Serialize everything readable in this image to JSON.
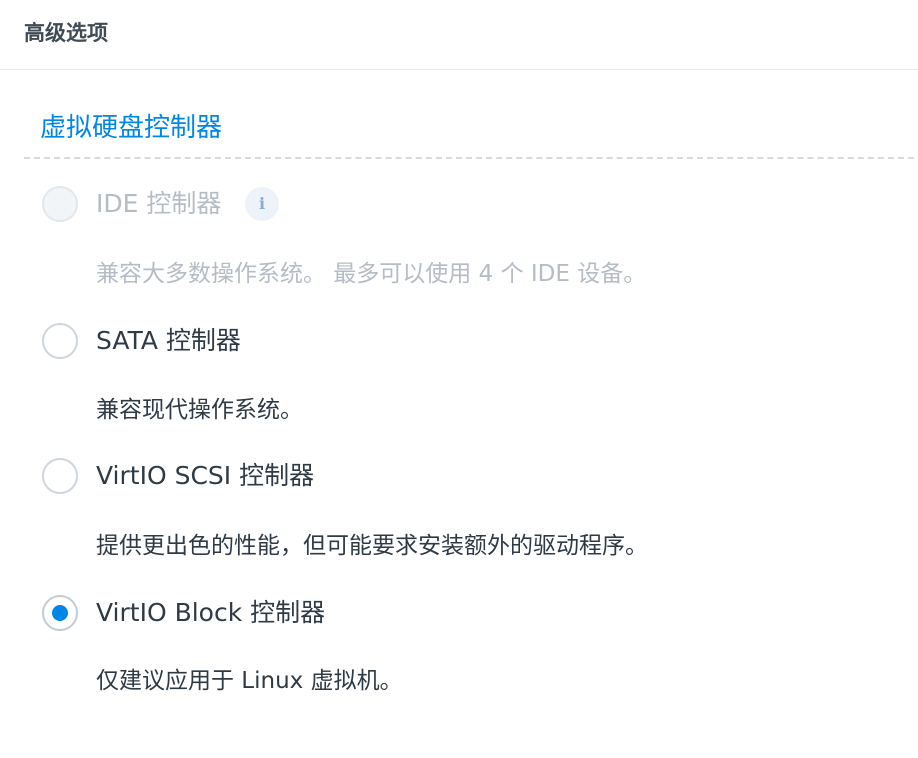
{
  "header": {
    "title": "高级选项"
  },
  "section": {
    "title": "虚拟硬盘控制器"
  },
  "options": [
    {
      "label": "IDE 控制器",
      "description": "兼容大多数操作系统。 最多可以使用 4 个 IDE 设备。",
      "disabled": true,
      "checked": false,
      "info_icon": "i"
    },
    {
      "label": "SATA 控制器",
      "description": "兼容现代操作系统。",
      "disabled": false,
      "checked": false
    },
    {
      "label": "VirtIO SCSI 控制器",
      "description": "提供更出色的性能，但可能要求安装额外的驱动程序。",
      "disabled": false,
      "checked": false
    },
    {
      "label": "VirtIO Block 控制器",
      "description": "仅建议应用于 Linux 虚拟机。",
      "disabled": false,
      "checked": true
    }
  ],
  "colors": {
    "accent": "#0086e5",
    "text": "#2f3a44",
    "disabled_text": "#b5bcc4",
    "divider": "#e3e6ea"
  },
  "icons": {
    "info": "info-icon"
  }
}
